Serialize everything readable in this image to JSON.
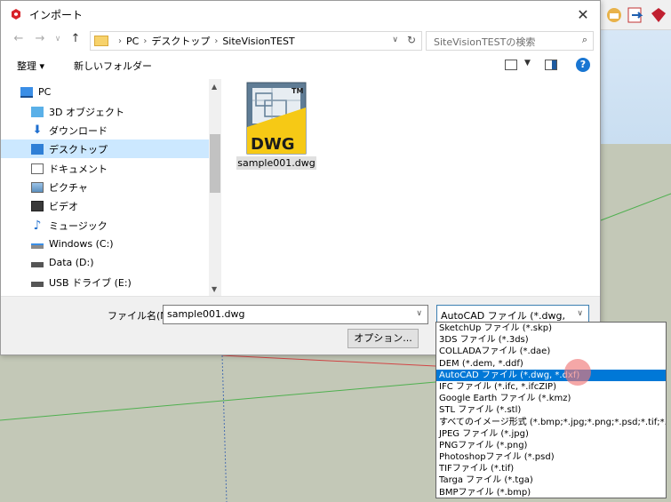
{
  "colors": {
    "accent": "#0078d7",
    "selection": "#cce8ff",
    "ground": "#c3c8b7",
    "axis_green": "#4fb04f",
    "axis_red": "#d24545"
  },
  "dialog": {
    "title": "インポート",
    "close_glyph": "✕"
  },
  "address": {
    "crumbs": [
      "PC",
      "デスクトップ",
      "SiteVisionTEST"
    ],
    "search_placeholder": "SiteVisionTESTの検索"
  },
  "toolbar": {
    "organize": "整理 ▾",
    "new_folder": "新しいフォルダー"
  },
  "nav": {
    "items": [
      {
        "label": "PC",
        "icon": "pc-icon"
      },
      {
        "label": "3D オブジェクト",
        "icon": "3d-objects-icon"
      },
      {
        "label": "ダウンロード",
        "icon": "download-icon"
      },
      {
        "label": "デスクトップ",
        "icon": "desktop-icon",
        "selected": true
      },
      {
        "label": "ドキュメント",
        "icon": "documents-icon"
      },
      {
        "label": "ピクチャ",
        "icon": "pictures-icon"
      },
      {
        "label": "ビデオ",
        "icon": "videos-icon"
      },
      {
        "label": "ミュージック",
        "icon": "music-icon"
      },
      {
        "label": "Windows (C:)",
        "icon": "drive-icon"
      },
      {
        "label": "Data (D:)",
        "icon": "drive-icon"
      },
      {
        "label": "USB ドライブ (E:)",
        "icon": "usb-drive-icon"
      }
    ]
  },
  "file": {
    "name": "sample001.dwg",
    "icon_text": "DWG",
    "icon_tm": "TM"
  },
  "bottom": {
    "filename_label": "ファイル名(N):",
    "filename_value": "sample001.dwg",
    "filetype_value": "AutoCAD ファイル (*.dwg, *.dxf)",
    "options_label": "オプション..."
  },
  "filetype_options": [
    "SketchUp ファイル (*.skp)",
    "3DS ファイル (*.3ds)",
    "COLLADAファイル (*.dae)",
    "DEM (*.dem, *.ddf)",
    "AutoCAD ファイル (*.dwg, *.dxf)",
    "IFC ファイル (*.ifc, *.ifcZIP)",
    "Google Earth ファイル (*.kmz)",
    "STL ファイル (*.stl)",
    "すべてのイメージ形式 (*.bmp;*.jpg;*.png;*.psd;*.tif;*.tga)",
    "JPEG ファイル (*.jpg)",
    "PNGファイル (*.png)",
    "Photoshopファイル (*.psd)",
    "TIFファイル (*.tif)",
    "Targa ファイル (*.tga)",
    "BMPファイル (*.bmp)"
  ],
  "selected_option_index": 4
}
